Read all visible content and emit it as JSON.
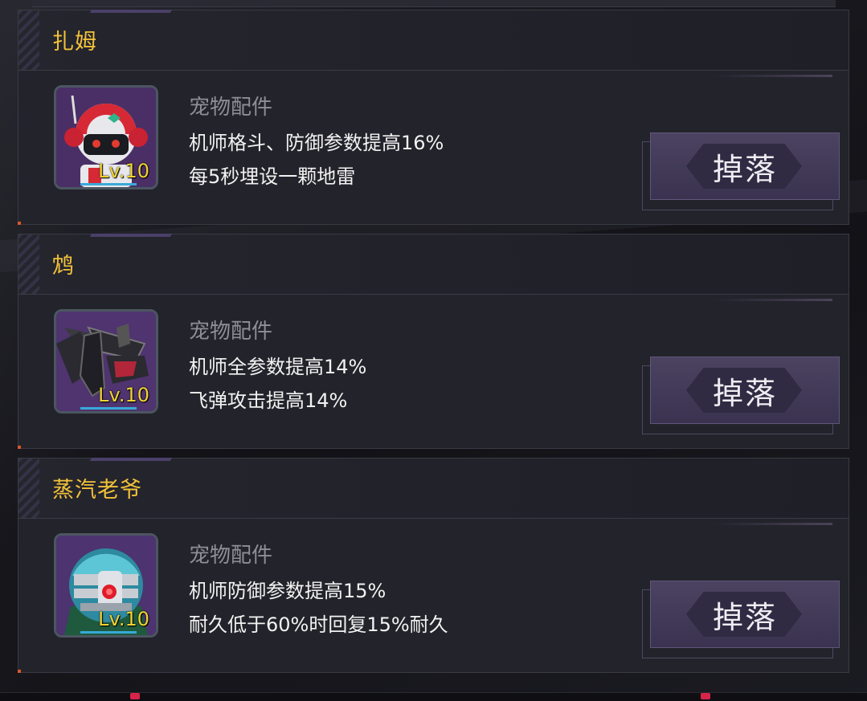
{
  "items": [
    {
      "name": "扎姆",
      "level": "Lv.10",
      "type": "宠物配件",
      "desc1": "机师格斗、防御参数提高16%",
      "desc2": "每5秒埋设一颗地雷",
      "drop_label": "掉落",
      "icon": "red-white-robot-icon"
    },
    {
      "name": "鸩",
      "level": "Lv.10",
      "type": "宠物配件",
      "desc1": "机师全参数提高14%",
      "desc2": "飞弹攻击提高14%",
      "drop_label": "掉落",
      "icon": "dark-mecha-bird-icon"
    },
    {
      "name": "蒸汽老爷",
      "level": "Lv.10",
      "type": "宠物配件",
      "desc1": "机师防御参数提高15%",
      "desc2": "耐久低于60%时回复15%耐久",
      "drop_label": "掉落",
      "icon": "teal-steam-robot-icon"
    }
  ],
  "colors": {
    "title": "#f2c23a",
    "level": "#f0d331",
    "button": "#4b4360",
    "panel": "#23232b"
  }
}
